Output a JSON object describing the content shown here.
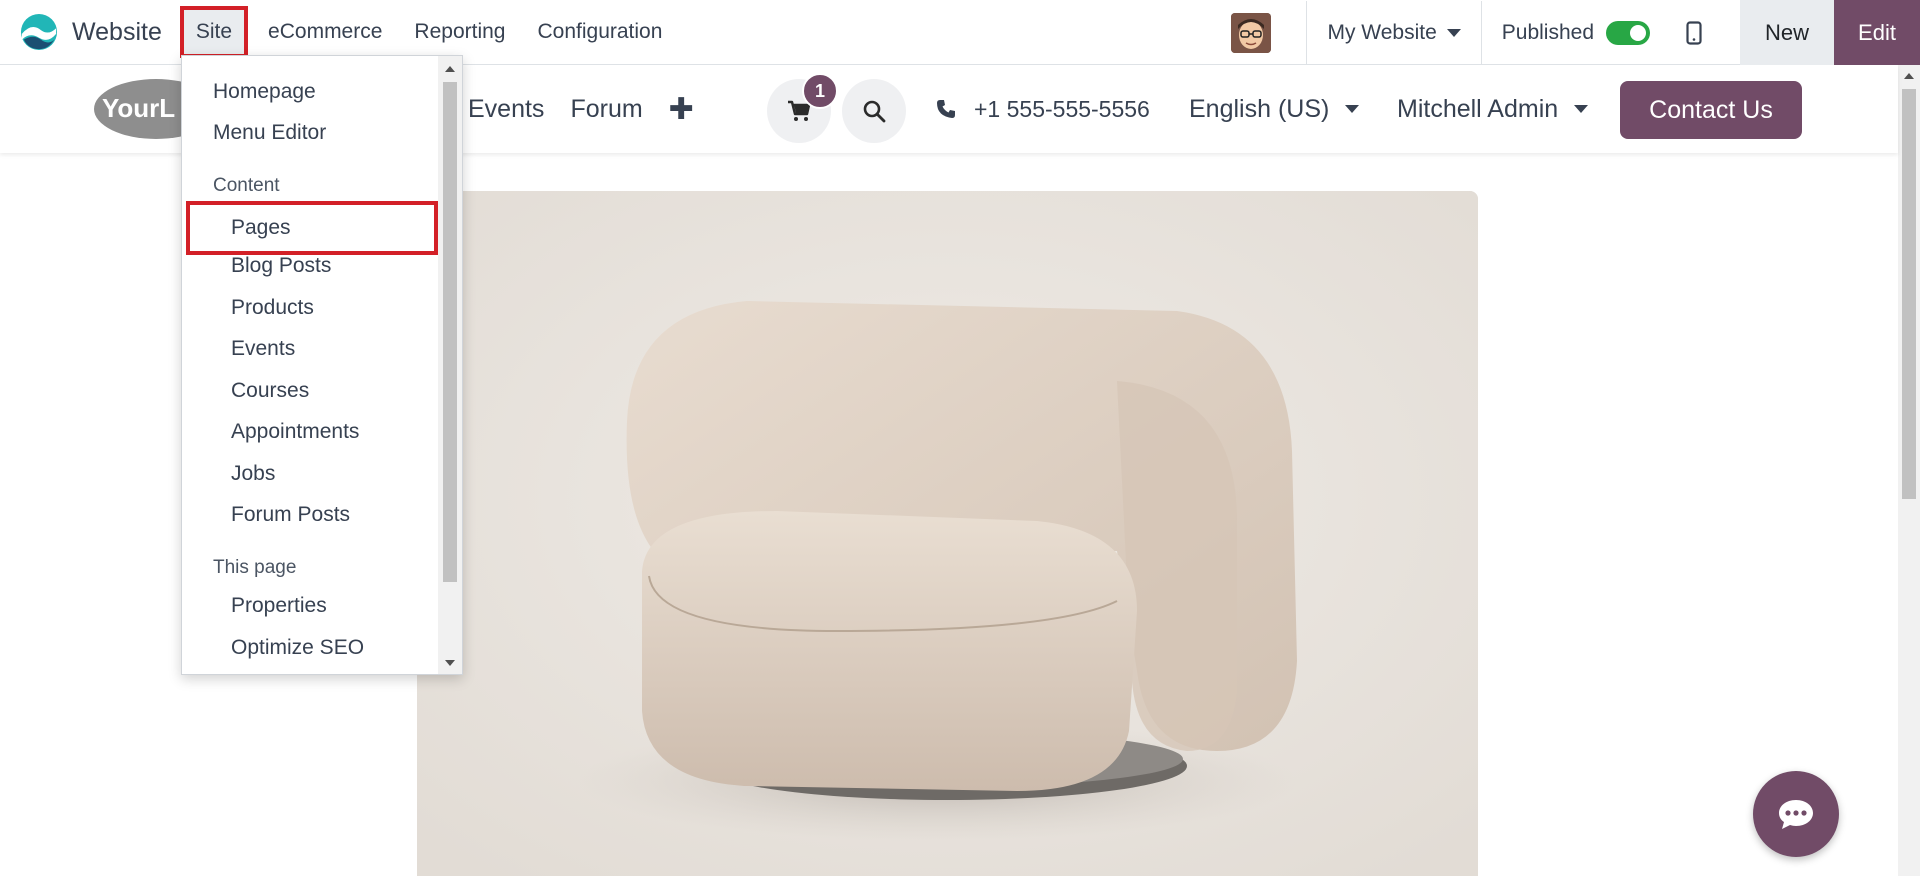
{
  "topbar": {
    "app_name": "Website",
    "menu": [
      {
        "label": "Site",
        "active": true
      },
      {
        "label": "eCommerce"
      },
      {
        "label": "Reporting"
      },
      {
        "label": "Configuration"
      }
    ],
    "website_selector": "My Website",
    "published_label": "Published",
    "published": true,
    "new_label": "New",
    "edit_label": "Edit"
  },
  "site_header": {
    "logo_text": "YourL",
    "nav": [
      "Events",
      "Forum"
    ],
    "cart_count": "1",
    "phone": "+1 555-555-5556",
    "language": "English (US)",
    "user": "Mitchell Admin",
    "contact_label": "Contact Us"
  },
  "dropdown": {
    "items": [
      {
        "label": "Homepage",
        "type": "item"
      },
      {
        "label": "Menu Editor",
        "type": "item"
      },
      {
        "label": "Content",
        "type": "header"
      },
      {
        "label": "Pages",
        "type": "sub",
        "highlighted": true
      },
      {
        "label": "Blog Posts",
        "type": "sub"
      },
      {
        "label": "Products",
        "type": "sub"
      },
      {
        "label": "Events",
        "type": "sub"
      },
      {
        "label": "Courses",
        "type": "sub"
      },
      {
        "label": "Appointments",
        "type": "sub"
      },
      {
        "label": "Jobs",
        "type": "sub"
      },
      {
        "label": "Forum Posts",
        "type": "sub"
      },
      {
        "label": "This page",
        "type": "header"
      },
      {
        "label": "Properties",
        "type": "sub"
      },
      {
        "label": "Optimize SEO",
        "type": "sub"
      }
    ]
  },
  "colors": {
    "brand": "#714b67",
    "highlight": "#d32027",
    "toggle_on": "#28a745"
  }
}
